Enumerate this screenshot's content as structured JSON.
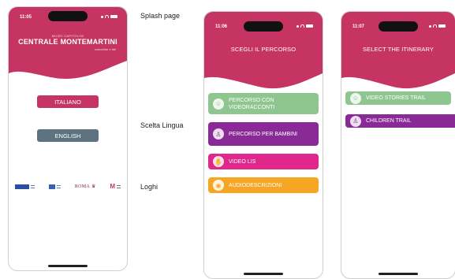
{
  "colors": {
    "brand_pink": "#c63463",
    "green": "#8fc58f",
    "purple": "#8a2a96",
    "magenta": "#e0288c",
    "orange": "#f6a623",
    "english_gray": "#5d7480"
  },
  "captions": {
    "splash": "Splash page",
    "language": "Scelta Lingua",
    "logos": "Loghi"
  },
  "splash": {
    "time": "11:05",
    "brand_small": "MUSEI CAPITOLINI",
    "brand_big": "CENTRALE MONTEMARTINI",
    "brand_sub": "macchine e dei",
    "btn_italiano": "ITALIANO",
    "btn_english": "ENGLISH",
    "logo_roma": "ROMA",
    "logo_m": "M"
  },
  "italian": {
    "time": "11:06",
    "title": "SCEGLI IL PERCORSO",
    "items": [
      {
        "label": "PERCORSO CON VIDEORACCONTI",
        "icon": "group-icon",
        "color": "#8fc58f"
      },
      {
        "label": "PERCORSO PER BAMBINI",
        "icon": "child-icon",
        "color": "#8a2a96"
      },
      {
        "label": "VIDEO LIS",
        "icon": "sign-language-icon",
        "color": "#e0288c"
      },
      {
        "label": "AUDIODESCRIZIONI",
        "icon": "eye-audio-icon",
        "color": "#f6a623"
      }
    ]
  },
  "english": {
    "time": "11:07",
    "title": "SELECT THE ITINERARY",
    "items": [
      {
        "label": "VIDEO STORIES TRAIL",
        "icon": "group-icon",
        "color": "#8fc58f"
      },
      {
        "label": "CHILDREN TRAIL",
        "icon": "child-icon",
        "color": "#8a2a96"
      }
    ]
  }
}
